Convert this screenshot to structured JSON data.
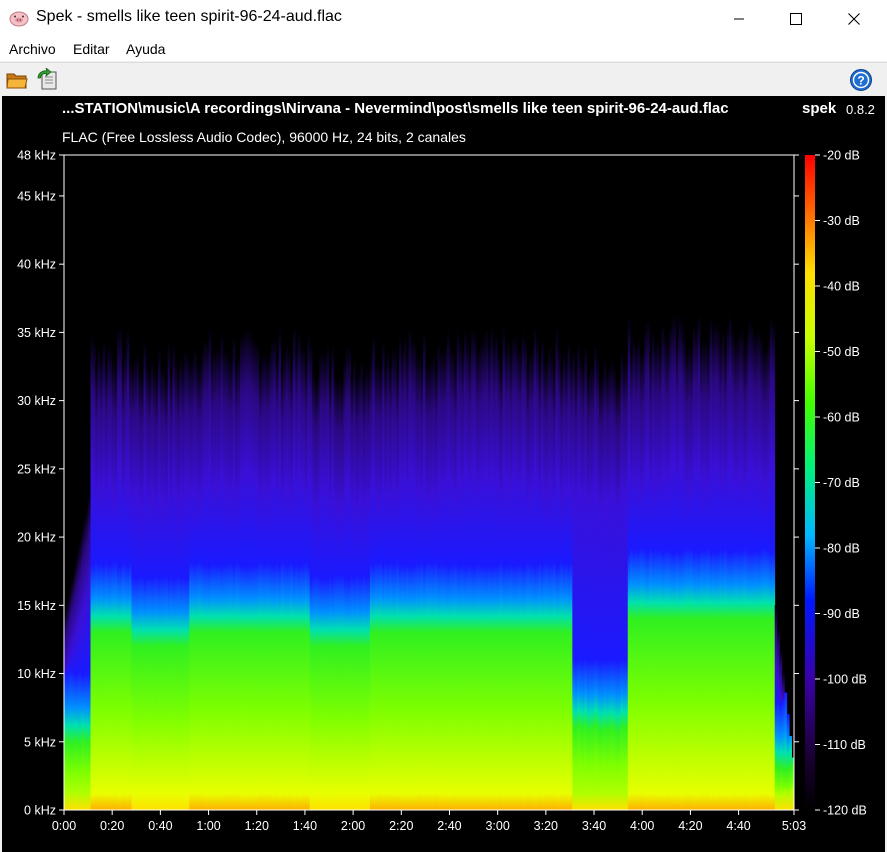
{
  "window": {
    "title": "Spek - smells like teen spirit-96-24-aud.flac",
    "icon": "pig-icon"
  },
  "menu": {
    "archivo": "Archivo",
    "editar": "Editar",
    "ayuda": "Ayuda"
  },
  "toolbar": {
    "open_icon": "folder-open-icon",
    "reload_icon": "reload-icon",
    "help_icon": "help-icon"
  },
  "header": {
    "file_path": "...STATION\\music\\A recordings\\Nirvana - Nevermind\\post\\smells like teen spirit-96-24-aud.flac",
    "app_name": "spek",
    "version": "0.8.2",
    "file_info": "FLAC (Free Lossless Audio Codec), 96000 Hz, 24 bits, 2 canales"
  },
  "chart_data": {
    "type": "heatmap",
    "y_axis": {
      "unit": "kHz",
      "range": [
        0,
        48
      ],
      "ticks": [
        {
          "value": 0,
          "label": "0 kHz"
        },
        {
          "value": 5,
          "label": "5 kHz"
        },
        {
          "value": 10,
          "label": "10 kHz"
        },
        {
          "value": 15,
          "label": "15 kHz"
        },
        {
          "value": 20,
          "label": "20 kHz"
        },
        {
          "value": 25,
          "label": "25 kHz"
        },
        {
          "value": 30,
          "label": "30 kHz"
        },
        {
          "value": 35,
          "label": "35 kHz"
        },
        {
          "value": 40,
          "label": "40 kHz"
        },
        {
          "value": 45,
          "label": "45 kHz"
        },
        {
          "value": 48,
          "label": "48 kHz"
        }
      ]
    },
    "x_axis": {
      "unit": "s",
      "range": [
        0,
        303
      ],
      "ticks": [
        {
          "value": 0,
          "label": "0:00"
        },
        {
          "value": 20,
          "label": "0:20"
        },
        {
          "value": 40,
          "label": "0:40"
        },
        {
          "value": 60,
          "label": "1:00"
        },
        {
          "value": 80,
          "label": "1:20"
        },
        {
          "value": 100,
          "label": "1:40"
        },
        {
          "value": 120,
          "label": "2:00"
        },
        {
          "value": 140,
          "label": "2:20"
        },
        {
          "value": 160,
          "label": "2:40"
        },
        {
          "value": 180,
          "label": "3:00"
        },
        {
          "value": 200,
          "label": "3:20"
        },
        {
          "value": 220,
          "label": "3:40"
        },
        {
          "value": 240,
          "label": "4:00"
        },
        {
          "value": 260,
          "label": "4:20"
        },
        {
          "value": 280,
          "label": "4:40"
        },
        {
          "value": 303,
          "label": "5:03"
        }
      ]
    },
    "colorbar": {
      "unit": "dB",
      "range": [
        -120,
        -20
      ],
      "ticks": [
        {
          "value": -20,
          "label": "-20 dB"
        },
        {
          "value": -30,
          "label": "-30 dB"
        },
        {
          "value": -40,
          "label": "-40 dB"
        },
        {
          "value": -50,
          "label": "-50 dB"
        },
        {
          "value": -60,
          "label": "-60 dB"
        },
        {
          "value": -70,
          "label": "-70 dB"
        },
        {
          "value": -80,
          "label": "-80 dB"
        },
        {
          "value": -90,
          "label": "-90 dB"
        },
        {
          "value": -100,
          "label": "-100 dB"
        },
        {
          "value": -110,
          "label": "-110 dB"
        },
        {
          "value": -120,
          "label": "-120 dB"
        }
      ]
    },
    "sections": [
      {
        "start": 0,
        "end": 11,
        "top_khz": 24,
        "green_khz": 5,
        "loudness": 0.5
      },
      {
        "start": 11,
        "end": 28,
        "top_khz": 34,
        "green_khz": 13,
        "loudness": 0.9
      },
      {
        "start": 28,
        "end": 52,
        "top_khz": 33,
        "green_khz": 12,
        "loudness": 0.75
      },
      {
        "start": 52,
        "end": 102,
        "top_khz": 34,
        "green_khz": 13,
        "loudness": 0.95
      },
      {
        "start": 102,
        "end": 127,
        "top_khz": 33,
        "green_khz": 12,
        "loudness": 0.75
      },
      {
        "start": 127,
        "end": 211,
        "top_khz": 34,
        "green_khz": 13,
        "loudness": 0.95
      },
      {
        "start": 211,
        "end": 234,
        "top_khz": 33,
        "green_khz": 6,
        "loudness": 0.65
      },
      {
        "start": 234,
        "end": 295,
        "top_khz": 35,
        "green_khz": 14,
        "loudness": 1.0
      },
      {
        "start": 295,
        "end": 303,
        "top_khz": 15,
        "green_khz": 3,
        "loudness": 0.4
      }
    ]
  }
}
